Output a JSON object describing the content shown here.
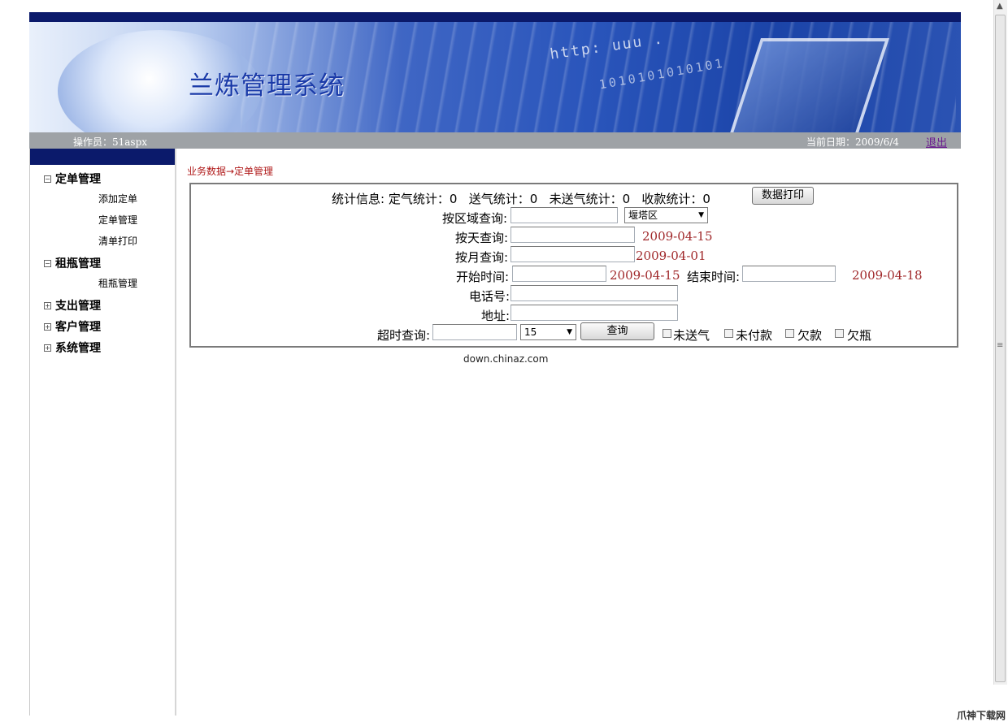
{
  "header": {
    "title": "兰炼管理系统",
    "banner_code_1": "http: uuu .",
    "banner_code_2": "1010101010101"
  },
  "infobar": {
    "operator": "操作员：51aspx",
    "date": "当前日期：2009/6/4",
    "logout_label": "退出"
  },
  "sidebar": {
    "groups": [
      {
        "label": "定单管理",
        "icon": "minus-box-icon",
        "items": [
          "添加定单",
          "定单管理",
          "清单打印"
        ]
      },
      {
        "label": "租瓶管理",
        "icon": "minus-box-icon",
        "items": [
          "租瓶管理"
        ]
      },
      {
        "label": "支出管理",
        "icon": "plus-box-icon",
        "items": []
      },
      {
        "label": "客户管理",
        "icon": "plus-box-icon",
        "items": []
      },
      {
        "label": "系统管理",
        "icon": "plus-box-icon",
        "items": []
      }
    ]
  },
  "breadcrumb": "业务数据→定单管理",
  "panel": {
    "stats": {
      "label": "统计信息:",
      "ding_qi": "定气统计：0",
      "song_qi": "送气统计：0",
      "wei_song_qi": "未送气统计：0",
      "shou_kuan": "收款统计：0",
      "print_button": "数据打印"
    },
    "area": {
      "label": "按区域查询:",
      "value": "",
      "select_value": "堰塔区"
    },
    "day": {
      "label": "按天查询:",
      "value": "",
      "date": "2009-04-15"
    },
    "month": {
      "label": "按月查询:",
      "value": "",
      "date": "2009-04-01"
    },
    "range": {
      "start_label": "开始时间:",
      "start_date": "2009-04-15",
      "end_label": "结束时间:",
      "end_date": "2009-04-18"
    },
    "phone": {
      "label": "电话号:",
      "value": ""
    },
    "address": {
      "label": "地址:",
      "value": ""
    },
    "timeout": {
      "label": "超时查询:",
      "select_value": "15",
      "query_button": "查询",
      "checkboxes": [
        {
          "label": "未送气",
          "checked": false
        },
        {
          "label": "未付款",
          "checked": false
        },
        {
          "label": "欠款",
          "checked": false
        },
        {
          "label": "欠瓶",
          "checked": false
        }
      ]
    }
  },
  "footer": "down.chinaz.com",
  "watermark": "爪神下载网"
}
